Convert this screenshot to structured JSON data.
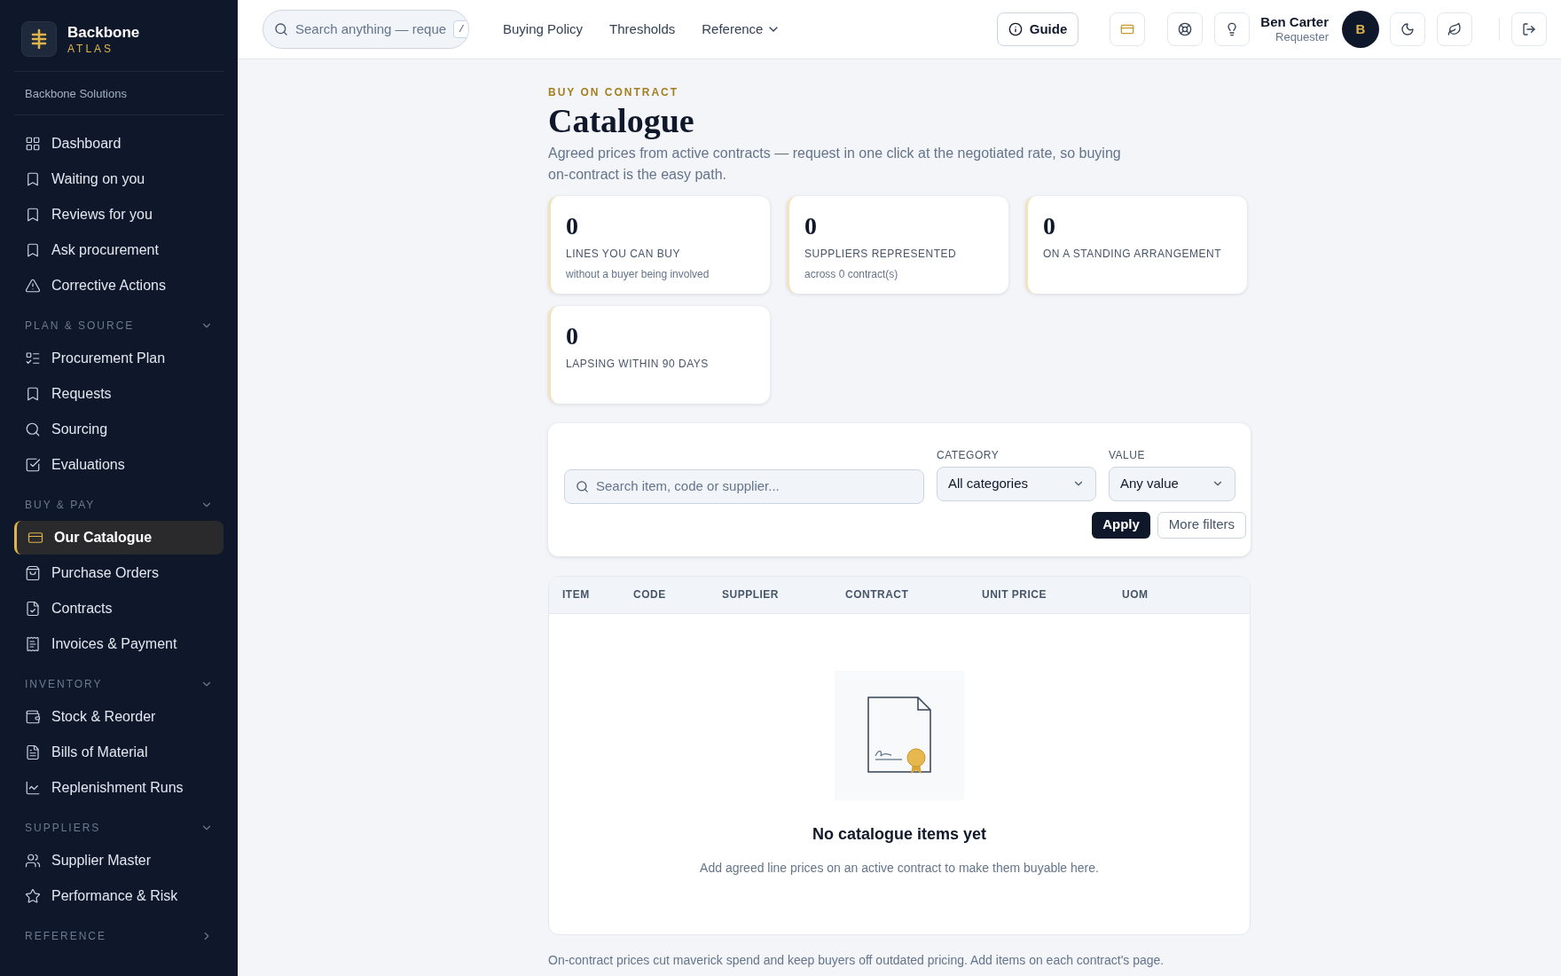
{
  "sidebar": {
    "brand": {
      "name": "Backbone",
      "subtitle": "ATLAS"
    },
    "org": "Backbone Solutions",
    "sections": [
      {
        "items": [
          {
            "label": "Dashboard",
            "selected": false
          },
          {
            "label": "Waiting on you",
            "selected": false
          },
          {
            "label": "Reviews for you",
            "selected": false
          },
          {
            "label": "Ask procurement",
            "selected": false
          },
          {
            "label": "Corrective Actions",
            "selected": false
          }
        ]
      },
      {
        "heading": "PLAN & SOURCE",
        "expanded": true,
        "items": [
          {
            "label": "Procurement Plan",
            "selected": false
          },
          {
            "label": "Requests",
            "selected": false
          },
          {
            "label": "Sourcing",
            "selected": false
          },
          {
            "label": "Evaluations",
            "selected": false
          }
        ]
      },
      {
        "heading": "BUY & PAY",
        "expanded": true,
        "items": [
          {
            "label": "Our Catalogue",
            "selected": true
          },
          {
            "label": "Purchase Orders",
            "selected": false
          },
          {
            "label": "Contracts",
            "selected": false
          },
          {
            "label": "Invoices & Payment",
            "selected": false
          }
        ]
      },
      {
        "heading": "INVENTORY",
        "expanded": true,
        "items": [
          {
            "label": "Stock & Reorder",
            "selected": false
          },
          {
            "label": "Bills of Material",
            "selected": false
          },
          {
            "label": "Replenishment Runs",
            "selected": false
          }
        ]
      },
      {
        "heading": "SUPPLIERS",
        "expanded": true,
        "items": [
          {
            "label": "Supplier Master",
            "selected": false
          },
          {
            "label": "Performance & Risk",
            "selected": false
          }
        ]
      },
      {
        "heading": "REFERENCE",
        "expanded": false
      }
    ]
  },
  "topbar": {
    "search": {
      "placeholder": "Search anything — reque",
      "shortcut": "/"
    },
    "links": [
      {
        "label": "Buying Policy",
        "kind": "link"
      },
      {
        "label": "Thresholds",
        "kind": "link"
      },
      {
        "label": "Reference",
        "kind": "dropdown"
      }
    ],
    "guide": "Guide",
    "user": {
      "name": "Ben Carter",
      "role": "Requester",
      "initial": "B"
    }
  },
  "page": {
    "eyebrow": "BUY ON CONTRACT",
    "title": "Catalogue",
    "description": "Agreed prices from active contracts — request in one click at the negotiated rate, so buying on-contract is the easy path.",
    "stats": [
      {
        "value": "0",
        "label": "LINES YOU CAN BUY",
        "note": "without a buyer being involved"
      },
      {
        "value": "0",
        "label": "SUPPLIERS REPRESENTED",
        "note": "across 0 contract(s)"
      },
      {
        "value": "0",
        "label": "ON A STANDING ARRANGEMENT"
      },
      {
        "value": "0",
        "label": "LAPSING WITHIN 90 DAYS"
      }
    ],
    "filters": {
      "search_placeholder": "Search item, code or supplier...",
      "category": {
        "label": "CATEGORY",
        "value": "All categories"
      },
      "value": {
        "label": "VALUE",
        "value": "Any value"
      },
      "apply": "Apply",
      "more": "More filters"
    },
    "table": {
      "columns": [
        "ITEM",
        "CODE",
        "SUPPLIER",
        "CONTRACT",
        "UNIT PRICE",
        "UOM"
      ],
      "empty": {
        "title": "No catalogue items yet",
        "text": "Add agreed line prices on an active contract to make them buyable here."
      }
    },
    "footer": "On-contract prices cut maverick spend and keep buyers off outdated pricing. Add items on each contract's page."
  }
}
